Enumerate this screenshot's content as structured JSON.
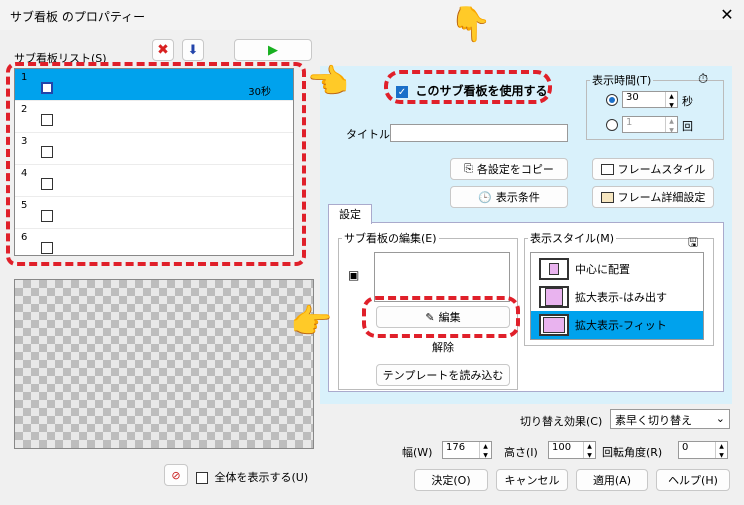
{
  "window": {
    "title": "サブ看板 のプロパティー",
    "close": "✕"
  },
  "list": {
    "label": "サブ看板リスト(S)",
    "rows": [
      {
        "num": "1",
        "checked": true,
        "duration": "30秒"
      },
      {
        "num": "2",
        "checked": false,
        "duration": ""
      },
      {
        "num": "3",
        "checked": false,
        "duration": ""
      },
      {
        "num": "4",
        "checked": false,
        "duration": ""
      },
      {
        "num": "5",
        "checked": false,
        "duration": ""
      },
      {
        "num": "6",
        "checked": false,
        "duration": ""
      }
    ]
  },
  "toolbar": {
    "delete_icon": "✖",
    "down_icon": "⬇",
    "play_icon": "▶"
  },
  "use_checkbox": {
    "label": "このサブ看板を使用する",
    "checked": true
  },
  "display_time": {
    "label": "表示時間(T)",
    "seconds_value": "30",
    "seconds_unit": "秒",
    "count_value": "1",
    "count_unit": "回"
  },
  "title_field": {
    "label": "タイトル",
    "value": ""
  },
  "buttons": {
    "copy_settings": "各設定をコピー",
    "display_conditions": "表示条件",
    "frame_style": "フレームスタイル",
    "frame_detail": "フレーム詳細設定",
    "edit": "編集",
    "release": "解除",
    "load_template": "テンプレートを読み込む",
    "ok": "決定(O)",
    "cancel": "キャンセル",
    "apply": "適用(A)",
    "help": "ヘルプ(H)"
  },
  "tab": {
    "label": "設定"
  },
  "edit_group": {
    "label": "サブ看板の編集(E)"
  },
  "style_group": {
    "label": "表示スタイル(M)",
    "items": [
      "中心に配置",
      "拡大表示-はみ出す",
      "拡大表示-フィット"
    ],
    "selected_index": 2
  },
  "switch_effect": {
    "label": "切り替え効果(C)",
    "value": "素早く切り替え"
  },
  "geometry": {
    "width_label": "幅(W)",
    "width_value": "176",
    "height_label": "高さ(I)",
    "height_value": "100",
    "rotation_label": "回転角度(R)",
    "rotation_value": "0"
  },
  "show_all": {
    "label": "全体を表示する(U)",
    "checked": false
  },
  "colors": {
    "accent": "#00a2ed",
    "highlight_dash": "#e0202a",
    "panel_bg": "#d9f1fb"
  }
}
